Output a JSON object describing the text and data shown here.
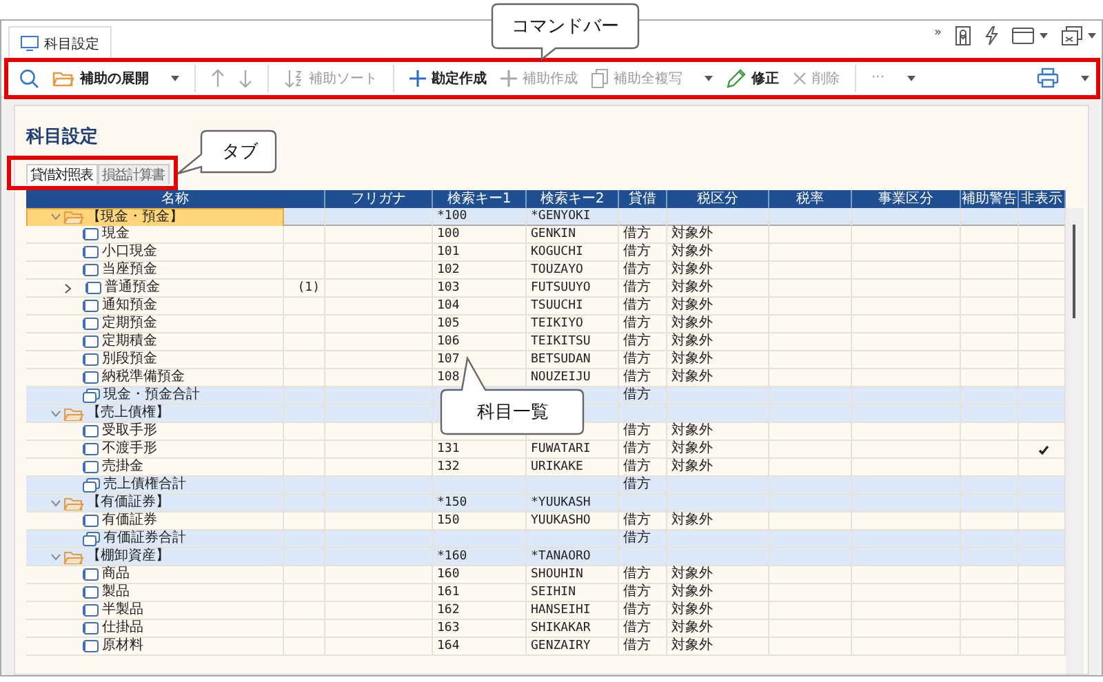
{
  "window_tab": {
    "label": "科目設定",
    "selected": true
  },
  "header_overflow": "»",
  "toolbar": {
    "items": [
      {
        "kind": "search"
      },
      {
        "kind": "button",
        "label": "補助の展開",
        "dropdown": true,
        "disabled": false
      },
      {
        "kind": "separator"
      },
      {
        "kind": "button",
        "disabled": true,
        "dropdown": false
      },
      {
        "kind": "button",
        "disabled": true,
        "dropdown": false
      },
      {
        "kind": "separator"
      },
      {
        "kind": "button",
        "label": "補助ソート",
        "disabled": true,
        "dropdown": false
      },
      {
        "kind": "separator"
      },
      {
        "kind": "button",
        "label": "勘定作成",
        "disabled": false,
        "dropdown": false
      },
      {
        "kind": "button",
        "label": "補助作成",
        "disabled": true,
        "dropdown": false
      },
      {
        "kind": "button",
        "label": "補助全複写",
        "disabled": true,
        "dropdown": true
      },
      {
        "kind": "button",
        "label": "修正",
        "disabled": false,
        "dropdown": false
      },
      {
        "kind": "button",
        "label": "削除",
        "disabled": true,
        "dropdown": false
      },
      {
        "kind": "separator"
      },
      {
        "kind": "button",
        "label": "···",
        "disabled": true,
        "dropdown": true
      },
      {
        "kind": "spacer"
      },
      {
        "kind": "button",
        "disabled": false,
        "dropdown": true
      }
    ]
  },
  "page_title": "科目設定",
  "tabs": [
    {
      "label": "貸借対照表",
      "selected": true
    },
    {
      "label": "損益計算書",
      "selected": false
    }
  ],
  "table": {
    "columns": [
      "名称",
      "フリガナ",
      "検索キー1",
      "検索キー2",
      "貸借",
      "税区分",
      "税率",
      "事業区分",
      "補助警告",
      "非表示"
    ],
    "rows": [
      {
        "kind": "group",
        "name": "【現金・預金】",
        "selected": true,
        "expanded": true,
        "key1": "*100",
        "key2": "*GENYOKI",
        "children": [
          {
            "kind": "item",
            "name": "現金",
            "selected": false,
            "expandable": false,
            "key1": "100",
            "key2": "GENKIN",
            "balance": "借方",
            "tax": "対象外",
            "hidden": false
          },
          {
            "kind": "item",
            "name": "小口現金",
            "selected": false,
            "expandable": false,
            "key1": "101",
            "key2": "KOGUCHI",
            "balance": "借方",
            "tax": "対象外",
            "hidden": false
          },
          {
            "kind": "item",
            "name": "当座預金",
            "selected": false,
            "expandable": false,
            "key1": "102",
            "key2": "TOUZAYO",
            "balance": "借方",
            "tax": "対象外",
            "hidden": false
          },
          {
            "kind": "item",
            "name": "普通預金",
            "count": "(1)",
            "selected": false,
            "expandable": true,
            "key1": "103",
            "key2": "FUTSUUYO",
            "balance": "借方",
            "tax": "対象外",
            "hidden": false
          },
          {
            "kind": "item",
            "name": "通知預金",
            "selected": false,
            "expandable": false,
            "key1": "104",
            "key2": "TSUUCHI",
            "balance": "借方",
            "tax": "対象外",
            "hidden": false
          },
          {
            "kind": "item",
            "name": "定期預金",
            "selected": false,
            "expandable": false,
            "key1": "105",
            "key2": "TEIKIYO",
            "balance": "借方",
            "tax": "対象外",
            "hidden": false
          },
          {
            "kind": "item",
            "name": "定期積金",
            "selected": false,
            "expandable": false,
            "key1": "106",
            "key2": "TEIKITSU",
            "balance": "借方",
            "tax": "対象外",
            "hidden": false
          },
          {
            "kind": "item",
            "name": "別段預金",
            "selected": false,
            "expandable": false,
            "key1": "107",
            "key2": "BETSUDAN",
            "balance": "借方",
            "tax": "対象外",
            "hidden": false
          },
          {
            "kind": "item",
            "name": "納税準備預金",
            "selected": false,
            "expandable": false,
            "key1": "108",
            "key2": "NOUZEIJU",
            "balance": "借方",
            "tax": "対象外",
            "hidden": false
          },
          {
            "kind": "total",
            "name": "現金・預金合計",
            "selected": false,
            "balance": "借方"
          }
        ]
      },
      {
        "kind": "group",
        "name": "【売上債権】",
        "selected": false,
        "expanded": true,
        "children": [
          {
            "kind": "item",
            "name": "受取手形",
            "selected": false,
            "expandable": false,
            "balance": "借方",
            "tax": "対象外",
            "hidden": false
          },
          {
            "kind": "item",
            "name": "不渡手形",
            "selected": false,
            "expandable": false,
            "key1": "131",
            "key2": "FUWATARI",
            "balance": "借方",
            "tax": "対象外",
            "hidden": true
          },
          {
            "kind": "item",
            "name": "売掛金",
            "selected": false,
            "expandable": false,
            "key1": "132",
            "key2": "URIKAKE",
            "balance": "借方",
            "tax": "対象外",
            "hidden": false
          },
          {
            "kind": "total",
            "name": "売上債権合計",
            "selected": false,
            "balance": "借方"
          }
        ]
      },
      {
        "kind": "group",
        "name": "【有価証券】",
        "selected": false,
        "expanded": true,
        "key1": "*150",
        "key2": "*YUUKASH",
        "children": [
          {
            "kind": "item",
            "name": "有価証券",
            "selected": false,
            "expandable": false,
            "key1": "150",
            "key2": "YUUKASHO",
            "balance": "借方",
            "tax": "対象外",
            "hidden": false
          },
          {
            "kind": "total",
            "name": "有価証券合計",
            "selected": false,
            "balance": "借方"
          }
        ]
      },
      {
        "kind": "group",
        "name": "【棚卸資産】",
        "selected": false,
        "expanded": true,
        "key1": "*160",
        "key2": "*TANAORO",
        "children": [
          {
            "kind": "item",
            "name": "商品",
            "selected": false,
            "expandable": false,
            "key1": "160",
            "key2": "SHOUHIN",
            "balance": "借方",
            "tax": "対象外",
            "hidden": false
          },
          {
            "kind": "item",
            "name": "製品",
            "selected": false,
            "expandable": false,
            "key1": "161",
            "key2": "SEIHIN",
            "balance": "借方",
            "tax": "対象外",
            "hidden": false
          },
          {
            "kind": "item",
            "name": "半製品",
            "selected": false,
            "expandable": false,
            "key1": "162",
            "key2": "HANSEIHI",
            "balance": "借方",
            "tax": "対象外",
            "hidden": false
          },
          {
            "kind": "item",
            "name": "仕掛品",
            "selected": false,
            "expandable": false,
            "key1": "163",
            "key2": "SHIKAKAR",
            "balance": "借方",
            "tax": "対象外",
            "hidden": false
          },
          {
            "kind": "item",
            "name": "原材料",
            "selected": false,
            "expandable": false,
            "key1": "164",
            "key2": "GENZAIRY",
            "balance": "借方",
            "tax": "対象外",
            "hidden": false
          }
        ]
      }
    ]
  },
  "callouts": [
    {
      "text": "コマンドバー"
    },
    {
      "text": "タブ"
    },
    {
      "text": "科目一覧"
    }
  ]
}
